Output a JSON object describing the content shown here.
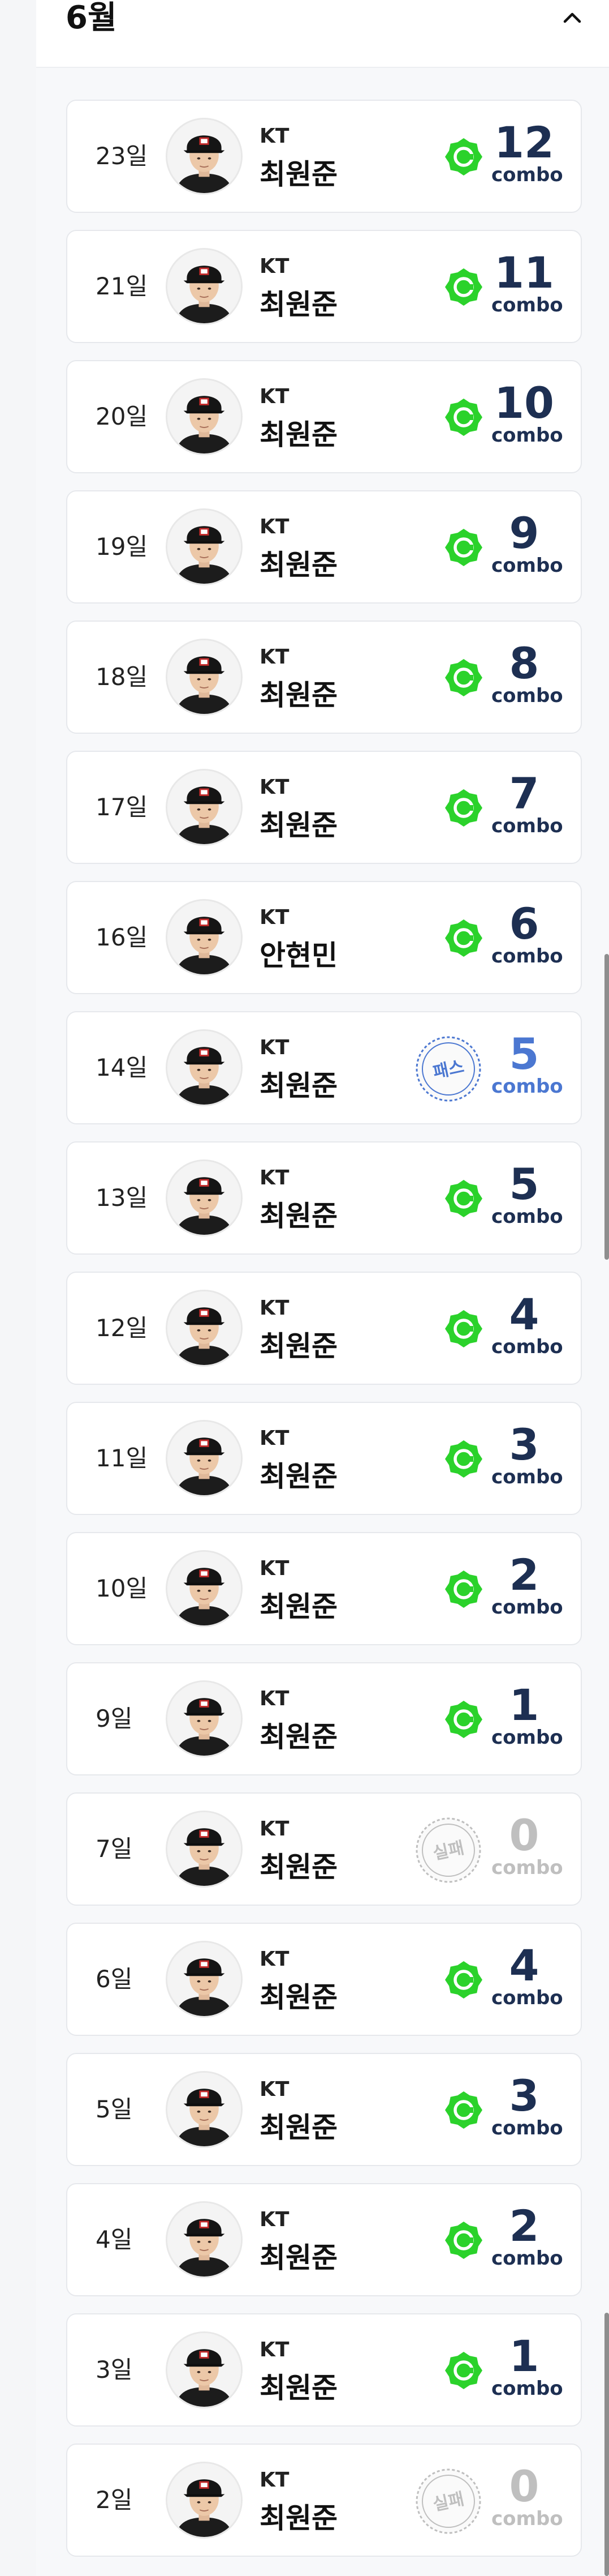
{
  "header": {
    "month": "6월",
    "collapse_icon": "chevron-up-icon"
  },
  "colors": {
    "success": "#2bd22b",
    "pass": "#4b77d1",
    "fail": "#bfbfbf",
    "combo": "#1d2f52"
  },
  "entries": [
    {
      "day": "23일",
      "team": "KT",
      "player": "최원준",
      "status": "success",
      "combo": "12",
      "combo_label": "combo"
    },
    {
      "day": "21일",
      "team": "KT",
      "player": "최원준",
      "status": "success",
      "combo": "11",
      "combo_label": "combo"
    },
    {
      "day": "20일",
      "team": "KT",
      "player": "최원준",
      "status": "success",
      "combo": "10",
      "combo_label": "combo"
    },
    {
      "day": "19일",
      "team": "KT",
      "player": "최원준",
      "status": "success",
      "combo": "9",
      "combo_label": "combo"
    },
    {
      "day": "18일",
      "team": "KT",
      "player": "최원준",
      "status": "success",
      "combo": "8",
      "combo_label": "combo"
    },
    {
      "day": "17일",
      "team": "KT",
      "player": "최원준",
      "status": "success",
      "combo": "7",
      "combo_label": "combo"
    },
    {
      "day": "16일",
      "team": "KT",
      "player": "안현민",
      "status": "success",
      "combo": "6",
      "combo_label": "combo"
    },
    {
      "day": "14일",
      "team": "KT",
      "player": "최원준",
      "status": "pass",
      "stamp": "패스",
      "combo": "5",
      "combo_label": "combo"
    },
    {
      "day": "13일",
      "team": "KT",
      "player": "최원준",
      "status": "success",
      "combo": "5",
      "combo_label": "combo"
    },
    {
      "day": "12일",
      "team": "KT",
      "player": "최원준",
      "status": "success",
      "combo": "4",
      "combo_label": "combo"
    },
    {
      "day": "11일",
      "team": "KT",
      "player": "최원준",
      "status": "success",
      "combo": "3",
      "combo_label": "combo"
    },
    {
      "day": "10일",
      "team": "KT",
      "player": "최원준",
      "status": "success",
      "combo": "2",
      "combo_label": "combo"
    },
    {
      "day": "9일",
      "team": "KT",
      "player": "최원준",
      "status": "success",
      "combo": "1",
      "combo_label": "combo"
    },
    {
      "day": "7일",
      "team": "KT",
      "player": "최원준",
      "status": "fail",
      "stamp": "실패",
      "combo": "0",
      "combo_label": "combo"
    },
    {
      "day": "6일",
      "team": "KT",
      "player": "최원준",
      "status": "success",
      "combo": "4",
      "combo_label": "combo"
    },
    {
      "day": "5일",
      "team": "KT",
      "player": "최원준",
      "status": "success",
      "combo": "3",
      "combo_label": "combo"
    },
    {
      "day": "4일",
      "team": "KT",
      "player": "최원준",
      "status": "success",
      "combo": "2",
      "combo_label": "combo"
    },
    {
      "day": "3일",
      "team": "KT",
      "player": "최원준",
      "status": "success",
      "combo": "1",
      "combo_label": "combo"
    },
    {
      "day": "2일",
      "team": "KT",
      "player": "최원준",
      "status": "fail",
      "stamp": "실패",
      "combo": "0",
      "combo_label": "combo"
    }
  ]
}
